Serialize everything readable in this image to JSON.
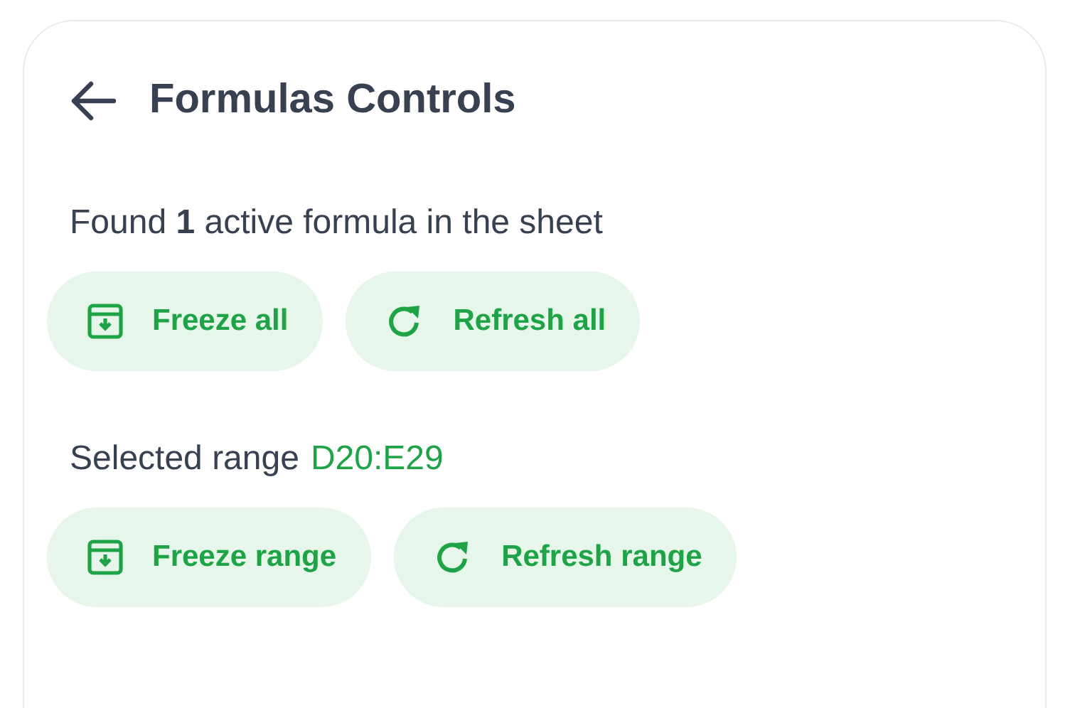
{
  "header": {
    "title": "Formulas Controls"
  },
  "sections": [
    {
      "kind": "summary",
      "text": "Found **1** active formula in the sheet",
      "buttons": [
        {
          "kind": "freeze",
          "label": "Freeze all"
        },
        {
          "kind": "refresh",
          "label": "Refresh all"
        }
      ]
    },
    {
      "kind": "range",
      "label": "Selected range",
      "value": "D20:E29",
      "buttons": [
        {
          "kind": "freeze",
          "label": "Freeze range"
        },
        {
          "kind": "refresh",
          "label": "Refresh range"
        }
      ]
    }
  ]
}
